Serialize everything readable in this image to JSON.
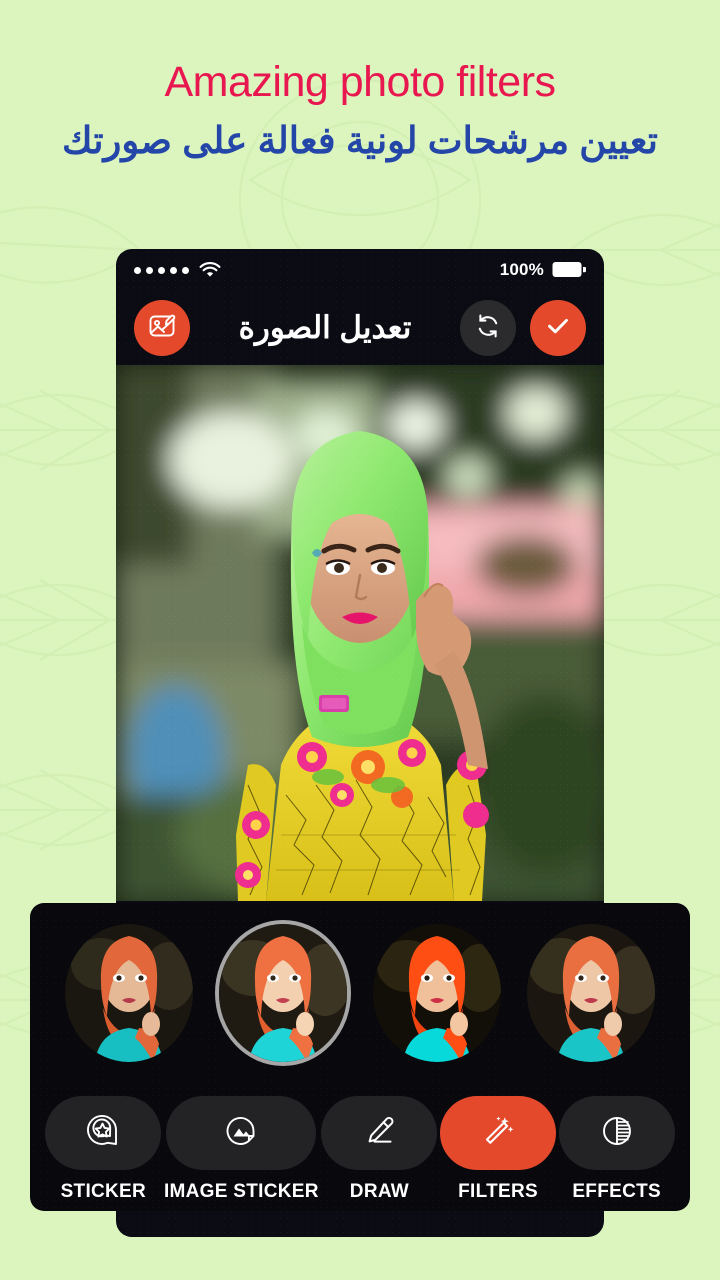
{
  "page": {
    "background_color": "#dcf5bf",
    "accent_color": "#e5492c",
    "title_color": "#e8174f",
    "subtitle_color": "#2346a8"
  },
  "headline": {
    "title": "Amazing photo filters",
    "subtitle": "تعيين مرشحات لونية فعالة على صورتك"
  },
  "statusbar": {
    "signal_dots": 5,
    "wifi_icon": "wifi-icon",
    "battery_percent": "100%",
    "battery_icon": "battery-full-icon"
  },
  "appbar": {
    "left_button_icon": "photo-edit-icon",
    "title": "تعديل الصورة",
    "reset_button_icon": "refresh-icon",
    "confirm_button_icon": "check-icon"
  },
  "canvas": {
    "description": "woman in bright green hijab and yellow floral batik dress, blurred bokeh background"
  },
  "filters": {
    "selected_index": 1,
    "items": [
      {
        "name": "filter-thumb-1",
        "selected": false
      },
      {
        "name": "filter-thumb-2",
        "selected": true
      },
      {
        "name": "filter-thumb-3",
        "selected": false
      },
      {
        "name": "filter-thumb-4",
        "selected": false
      }
    ]
  },
  "toolbar": {
    "active_index": 3,
    "items": [
      {
        "label": "STICKER",
        "icon": "sticker-star-icon",
        "active": false
      },
      {
        "label": "IMAGE STICKER",
        "icon": "sticker-image-icon",
        "active": false
      },
      {
        "label": "DRAW",
        "icon": "pencil-icon",
        "active": false
      },
      {
        "label": "FILTERS",
        "icon": "magic-wand-icon",
        "active": true
      },
      {
        "label": "EFFECTS",
        "icon": "contrast-circle-icon",
        "active": false
      }
    ]
  }
}
